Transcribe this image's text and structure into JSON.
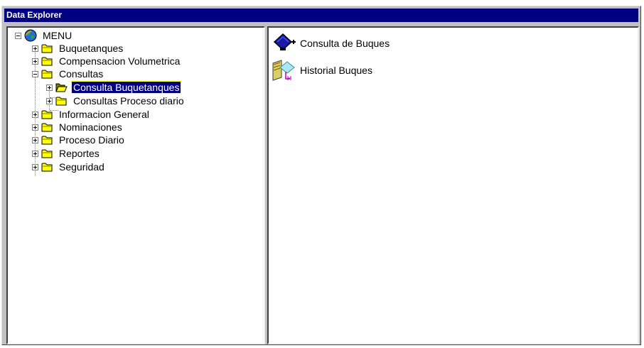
{
  "window": {
    "title": "Data Explorer"
  },
  "tree": {
    "root": "MENU",
    "items": [
      {
        "label": "Buquetanques"
      },
      {
        "label": "Compensacion Volumetrica"
      },
      {
        "label": "Consultas",
        "children": [
          {
            "label": "Consulta Buquetanques"
          },
          {
            "label": "Consultas Proceso diario"
          }
        ]
      },
      {
        "label": "Informacion General"
      },
      {
        "label": "Nominaciones"
      },
      {
        "label": "Proceso Diario"
      },
      {
        "label": "Reportes"
      },
      {
        "label": "Seguridad"
      }
    ]
  },
  "list": {
    "items": [
      {
        "label": "Consulta de Buques",
        "icon": "diamond-form-icon"
      },
      {
        "label": "Historial Buques",
        "icon": "history-form-icon"
      }
    ]
  },
  "colors": {
    "titlebar": "#000080",
    "selection": "#000080",
    "window": "#c0c0c0"
  }
}
